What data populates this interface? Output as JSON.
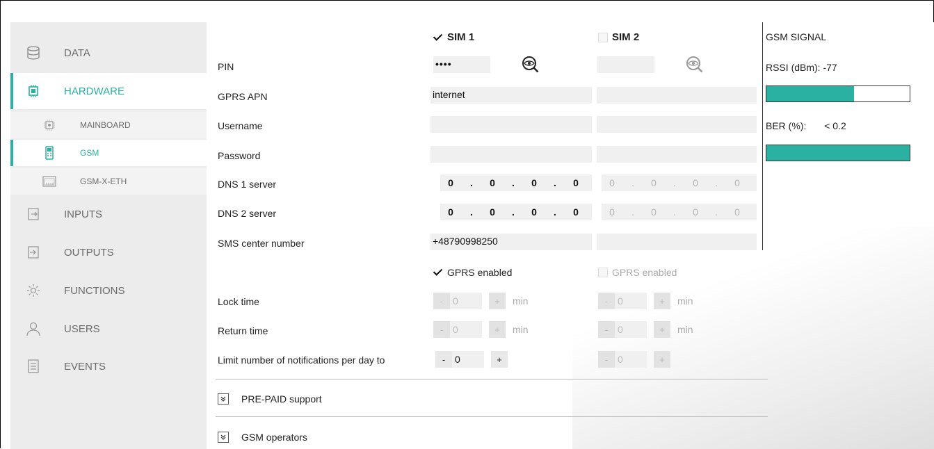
{
  "sidebar": {
    "items": [
      {
        "label": "DATA",
        "icon": "database-icon",
        "active": false
      },
      {
        "label": "HARDWARE",
        "icon": "chip-icon",
        "active": true
      },
      {
        "label": "INPUTS",
        "icon": "input-icon",
        "active": false
      },
      {
        "label": "OUTPUTS",
        "icon": "output-icon",
        "active": false
      },
      {
        "label": "FUNCTIONS",
        "icon": "gear-icon",
        "active": false
      },
      {
        "label": "USERS",
        "icon": "user-icon",
        "active": false
      },
      {
        "label": "EVENTS",
        "icon": "list-icon",
        "active": false
      }
    ],
    "sub_items": [
      {
        "label": "MAINBOARD",
        "icon": "mainboard-icon",
        "active": false
      },
      {
        "label": "GSM",
        "icon": "phone-icon",
        "active": true
      },
      {
        "label": "GSM-X-ETH",
        "icon": "ethernet-icon",
        "active": false
      }
    ]
  },
  "form": {
    "sim1": {
      "label": "SIM 1",
      "checked": true
    },
    "sim2": {
      "label": "SIM 2",
      "checked": false
    },
    "labels": {
      "pin": "PIN",
      "apn": "GPRS APN",
      "username": "Username",
      "password": "Password",
      "dns1": "DNS 1 server",
      "dns2": "DNS 2 server",
      "sms": "SMS center number",
      "lock": "Lock time",
      "return": "Return time",
      "limit": "Limit number of notifications per day to"
    },
    "sim1_values": {
      "pin": "••••",
      "apn": "internet",
      "username": "",
      "password": "",
      "dns1": [
        "0",
        "0",
        "0",
        "0"
      ],
      "dns2": [
        "0",
        "0",
        "0",
        "0"
      ],
      "sms": "+48790998250",
      "gprs_label": "GPRS enabled",
      "lock": "0",
      "return": "0",
      "limit": "0"
    },
    "sim2_values": {
      "pin": "",
      "apn": "",
      "username": "",
      "password": "",
      "dns1": [
        "0",
        "0",
        "0",
        "0"
      ],
      "dns2": [
        "0",
        "0",
        "0",
        "0"
      ],
      "sms": "",
      "gprs_label": "GPRS enabled",
      "lock": "0",
      "return": "0",
      "limit": "0"
    },
    "unit_min": "min",
    "dot": ".",
    "minus": "-",
    "plus": "+",
    "sections": [
      "PRE-PAID support",
      "GSM operators"
    ]
  },
  "signal": {
    "title": "GSM SIGNAL",
    "rssi_label": "RSSI (dBm):",
    "rssi_value": "-77",
    "rssi_fraction": 0.61,
    "ber_label": "BER (%):",
    "ber_value": "< 0.2",
    "ber_fraction": 1.0,
    "accent": "#2ab1a1"
  }
}
